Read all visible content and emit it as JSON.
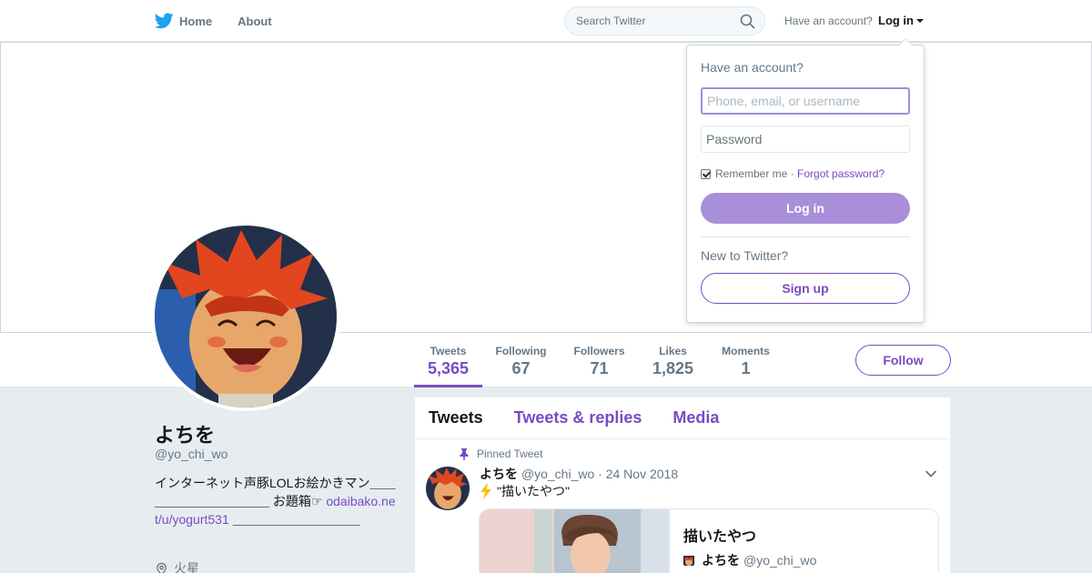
{
  "nav": {
    "home_label": "Home",
    "about_label": "About",
    "search_placeholder": "Search Twitter",
    "account_question": "Have an account?",
    "login_label": "Log in"
  },
  "profile_nav": {
    "stats": [
      {
        "label": "Tweets",
        "value": "5,365"
      },
      {
        "label": "Following",
        "value": "67"
      },
      {
        "label": "Followers",
        "value": "71"
      },
      {
        "label": "Likes",
        "value": "1,825"
      },
      {
        "label": "Moments",
        "value": "1"
      }
    ],
    "active_stat": "Tweets",
    "follow_label": "Follow"
  },
  "profile": {
    "name": "よちを",
    "handle": "@yo_chi_wo",
    "bio_text_1": "インターネット声豚LOLお絵かきマン＿＿＿＿＿＿＿＿＿＿＿ お題箱☞",
    "bio_link": "odaibako.net/u/yogurt531",
    "bio_text_2": " ＿＿＿＿＿＿＿＿＿＿",
    "location": "火星"
  },
  "timeline": {
    "tabs": [
      "Tweets",
      "Tweets & replies",
      "Media"
    ],
    "active_tab": "Tweets",
    "pinned_label": "Pinned Tweet",
    "tweet": {
      "name": "よちを",
      "handle": "@yo_chi_wo",
      "date": "· 24 Nov 2018",
      "text": "\"描いたやつ\"",
      "card_title": "描いたやつ",
      "card_author_name": "よちを",
      "card_author_handle": "@yo_chi_wo"
    }
  },
  "login_dropdown": {
    "title": "Have an account?",
    "username_placeholder": "Phone, email, or username",
    "password_placeholder": "Password",
    "remember_label": "Remember me",
    "separator": " · ",
    "forgot_label": "Forgot password?",
    "login_button": "Log in",
    "new_question": "New to Twitter?",
    "signup_button": "Sign up"
  },
  "colors": {
    "accent": "#794bc4",
    "twitter_blue": "#1da1f2",
    "background": "#e6ecf0"
  }
}
